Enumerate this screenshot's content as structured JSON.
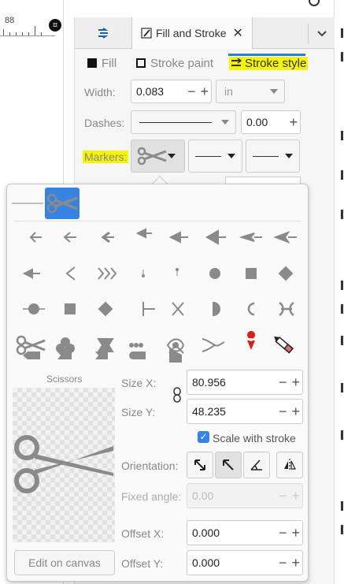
{
  "ruler": {
    "number": "88",
    "snap_label": "⌑"
  },
  "dock": {
    "tab_title": "Fill and Stroke",
    "close_glyph": "✕",
    "menu_glyph": "⌄",
    "subtabs": {
      "fill": "Fill",
      "stroke_paint": "Stroke paint",
      "stroke_style": "Stroke style"
    }
  },
  "stroke_style": {
    "width_label": "Width:",
    "width_value": "0.083",
    "width_unit": "in",
    "dashes_label": "Dashes:",
    "dashes_value": "0.00",
    "markers_label": "Markers:"
  },
  "marker_popover": {
    "selected_name": "Scissors",
    "size_x_label": "Size X:",
    "size_x_value": "80.956",
    "size_y_label": "Size Y:",
    "size_y_value": "48.235",
    "scale_with_stroke_label": "Scale with stroke",
    "scale_with_stroke_checked": true,
    "orientation_label": "Orientation:",
    "fixed_angle_label": "Fixed angle:",
    "fixed_angle_value": "0.00",
    "offset_x_label": "Offset X:",
    "offset_x_value": "0.000",
    "offset_y_label": "Offset Y:",
    "offset_y_value": "0.000",
    "edit_button_label": "Edit on canvas"
  },
  "colors": {
    "accent": "#3584e4",
    "highlight": "#f5f500",
    "marker_grey": "#8a8a8a",
    "pin_red": "#d52020"
  }
}
